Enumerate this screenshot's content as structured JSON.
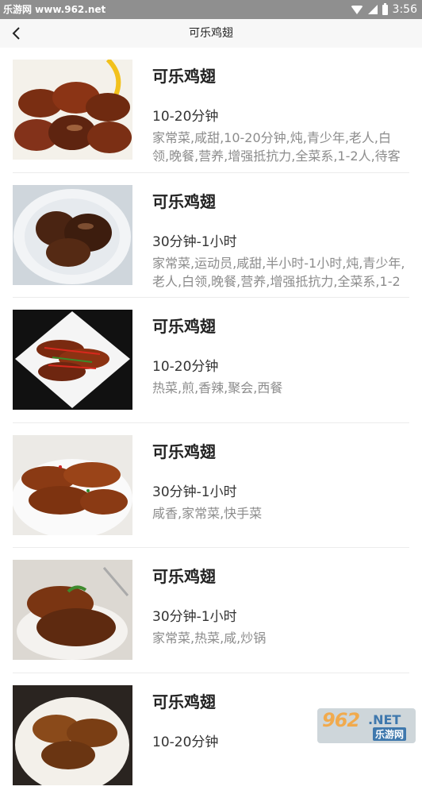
{
  "status_bar": {
    "site_text": "乐游网 www.962.net",
    "time": "3:56",
    "icons": [
      "wifi-icon",
      "signal-icon",
      "battery-icon"
    ]
  },
  "nav": {
    "back_icon": "chevron-left-icon",
    "title": "可乐鸡翅"
  },
  "recipes": [
    {
      "name": "可乐鸡翅",
      "time": "10-20分钟",
      "tags": "家常菜,咸甜,10-20分钟,炖,青少年,老人,白领,晚餐,营养,增强抵抗力,全菜系,1-2人,待客"
    },
    {
      "name": "可乐鸡翅",
      "time": "30分钟-1小时",
      "tags": "家常菜,运动员,咸甜,半小时-1小时,炖,青少年,老人,白领,晚餐,营养,增强抵抗力,全菜系,1-2"
    },
    {
      "name": "可乐鸡翅",
      "time": "10-20分钟",
      "tags": "热菜,煎,香辣,聚会,西餐"
    },
    {
      "name": "可乐鸡翅",
      "time": "30分钟-1小时",
      "tags": "咸香,家常菜,快手菜"
    },
    {
      "name": "可乐鸡翅",
      "time": "30分钟-1小时",
      "tags": "家常菜,热菜,咸,炒锅"
    },
    {
      "name": "可乐鸡翅",
      "time": "10-20分钟",
      "tags": ""
    }
  ],
  "watermark": {
    "number": "962",
    "net": ".NET",
    "cn": "乐游网"
  },
  "colors": {
    "status_bar": "#8f8f8f",
    "nav_bar": "#f7f7f7",
    "tag_text": "#8c8c8c",
    "divider": "#ececec"
  }
}
